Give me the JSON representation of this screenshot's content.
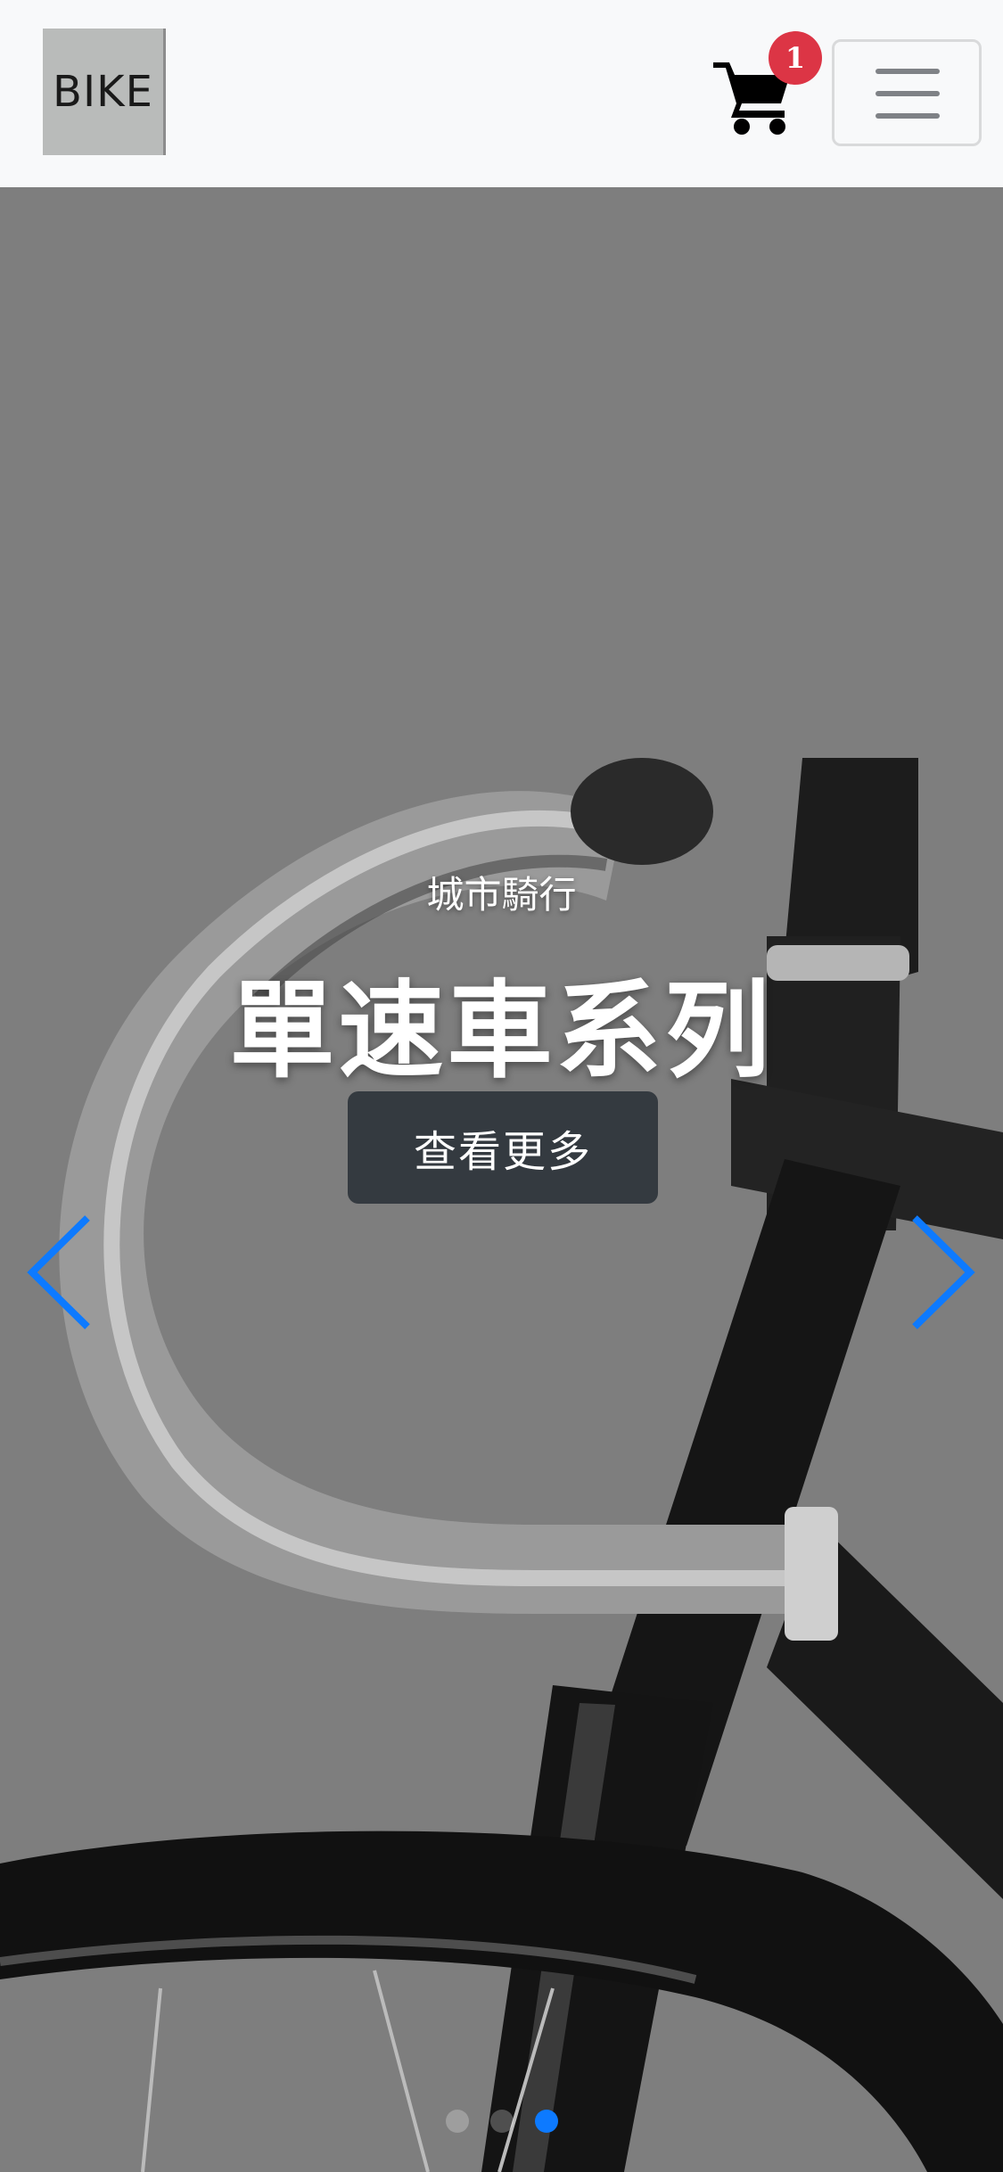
{
  "brand": {
    "logo_text": "BIKE"
  },
  "cart": {
    "count": "1",
    "icon": "shopping-cart-icon"
  },
  "menu": {
    "icon": "hamburger-menu-icon"
  },
  "hero": {
    "subtitle": "城市騎行",
    "title": "單速車系列",
    "cta_label": "查看更多",
    "prev_icon": "chevron-left-icon",
    "next_icon": "chevron-right-icon",
    "slides_total": 3,
    "active_slide": 3
  },
  "colors": {
    "navbar_bg": "#f8f9fa",
    "badge": "#dc3545",
    "cta_bg": "#343a40",
    "arrow": "#0d7aff",
    "active_indicator": "#0d7aff"
  }
}
